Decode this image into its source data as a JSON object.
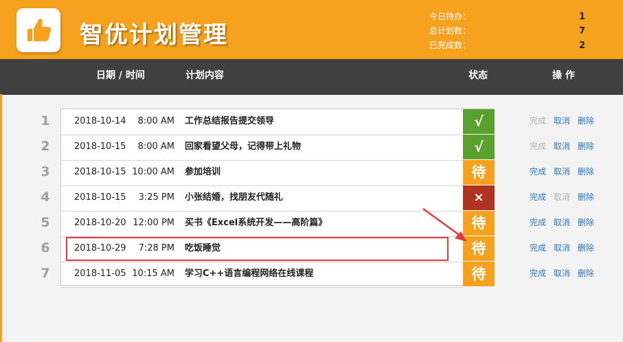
{
  "header": {
    "title": "智优计划管理",
    "logo_icon": "thumbs-up-icon",
    "stats": [
      {
        "label": "今日待办：",
        "value": "1"
      },
      {
        "label": "总计划数：",
        "value": "7"
      },
      {
        "label": "已完成数：",
        "value": "2"
      }
    ]
  },
  "columns": {
    "datetime": "日期 / 时间",
    "content": "计划内容",
    "status": "状态",
    "ops": "操 作"
  },
  "ops_labels": {
    "done": "完成",
    "cancel": "取消",
    "delete": "删除"
  },
  "colors": {
    "accent": "#f7a21e",
    "done": "#5aa02e",
    "cancel": "#b03322",
    "link": "#2a77be",
    "link_disabled": "#b0b0b0",
    "highlight": "#e5393e"
  },
  "rows": [
    {
      "num": "1",
      "date": "2018-10-14",
      "time": "8:00 AM",
      "content": "工作总结报告提交领导",
      "status": "√",
      "status_type": "done",
      "done_enabled": false,
      "cancel_enabled": true
    },
    {
      "num": "2",
      "date": "2018-10-15",
      "time": "8:00 AM",
      "content": "回家看望父母，记得带上礼物",
      "status": "√",
      "status_type": "done",
      "done_enabled": false,
      "cancel_enabled": true
    },
    {
      "num": "3",
      "date": "2018-10-15",
      "time": "10:00 AM",
      "content": "参加培训",
      "status": "待",
      "status_type": "wait",
      "done_enabled": true,
      "cancel_enabled": true
    },
    {
      "num": "4",
      "date": "2018-10-15",
      "time": "3:25 PM",
      "content": "小张结婚，找朋友代随礼",
      "status": "×",
      "status_type": "cancel",
      "done_enabled": true,
      "cancel_enabled": false
    },
    {
      "num": "5",
      "date": "2018-10-20",
      "time": "12:00 PM",
      "content": "买书《Excel系统开发——高阶篇》",
      "status": "待",
      "status_type": "wait",
      "done_enabled": true,
      "cancel_enabled": true
    },
    {
      "num": "6",
      "date": "2018-10-29",
      "time": "7:28 PM",
      "content": "吃饭睡觉",
      "status": "待",
      "status_type": "wait",
      "done_enabled": true,
      "cancel_enabled": true
    },
    {
      "num": "7",
      "date": "2018-11-05",
      "time": "10:15 AM",
      "content": "学习C++语言编程网络在线课程",
      "status": "待",
      "status_type": "wait",
      "done_enabled": true,
      "cancel_enabled": true
    }
  ]
}
